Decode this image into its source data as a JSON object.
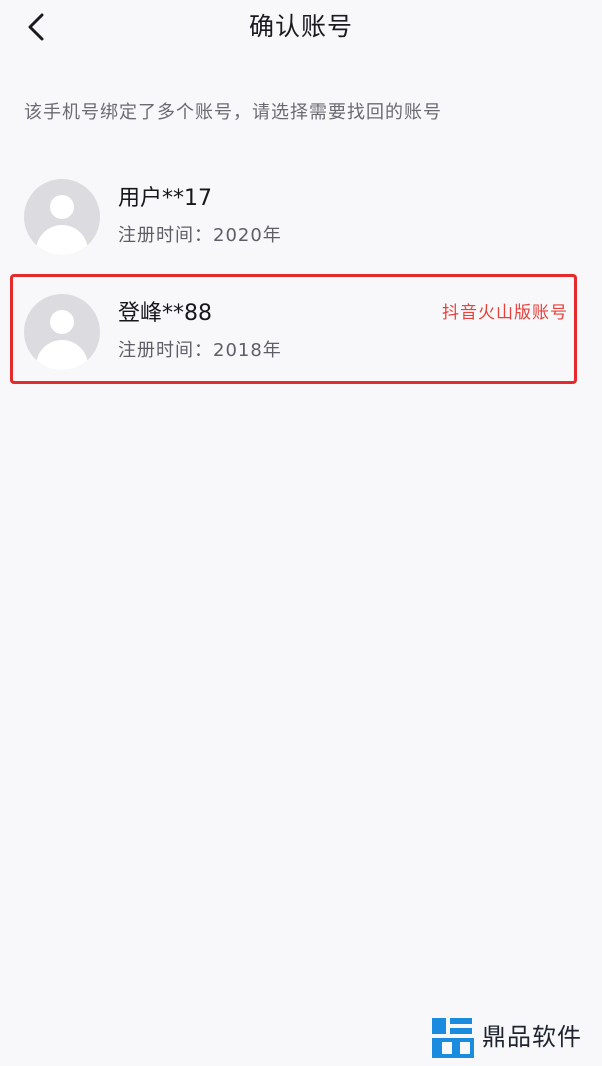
{
  "header": {
    "title": "确认账号",
    "back_icon": "chevron-left-icon"
  },
  "hint": "该手机号绑定了多个账号，请选择需要找回的账号",
  "accounts": [
    {
      "name": "用户**17",
      "reg_time": "注册时间：2020年",
      "avatar_icon": "default-avatar-icon"
    },
    {
      "name": "登峰**88",
      "reg_time": "注册时间：2018年",
      "tag": "抖音火山版账号",
      "avatar_icon": "default-avatar-icon",
      "highlighted": true
    }
  ],
  "colors": {
    "background": "#f8f8fa",
    "highlight_border": "#e42a2a",
    "tag_text": "#e8403a",
    "watermark_blue": "#1a8ce0"
  },
  "watermark": {
    "text": "鼎品软件",
    "logo_icon": "dingpin-logo-icon"
  }
}
